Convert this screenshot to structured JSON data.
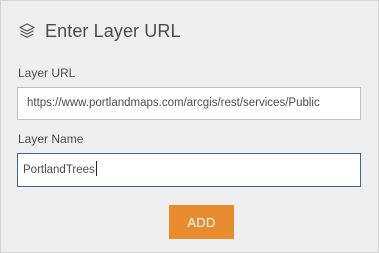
{
  "header": {
    "icon": "layers-icon",
    "title": "Enter Layer URL"
  },
  "layer_url": {
    "label": "Layer URL",
    "value": "https://www.portlandmaps.com/arcgis/rest/services/Public"
  },
  "layer_name": {
    "label": "Layer Name",
    "value": "PortlandTrees"
  },
  "actions": {
    "add_label": "ADD"
  },
  "colors": {
    "accent": "#e98c2f",
    "focus_border": "#3b6592",
    "panel_bg": "#efefef"
  }
}
